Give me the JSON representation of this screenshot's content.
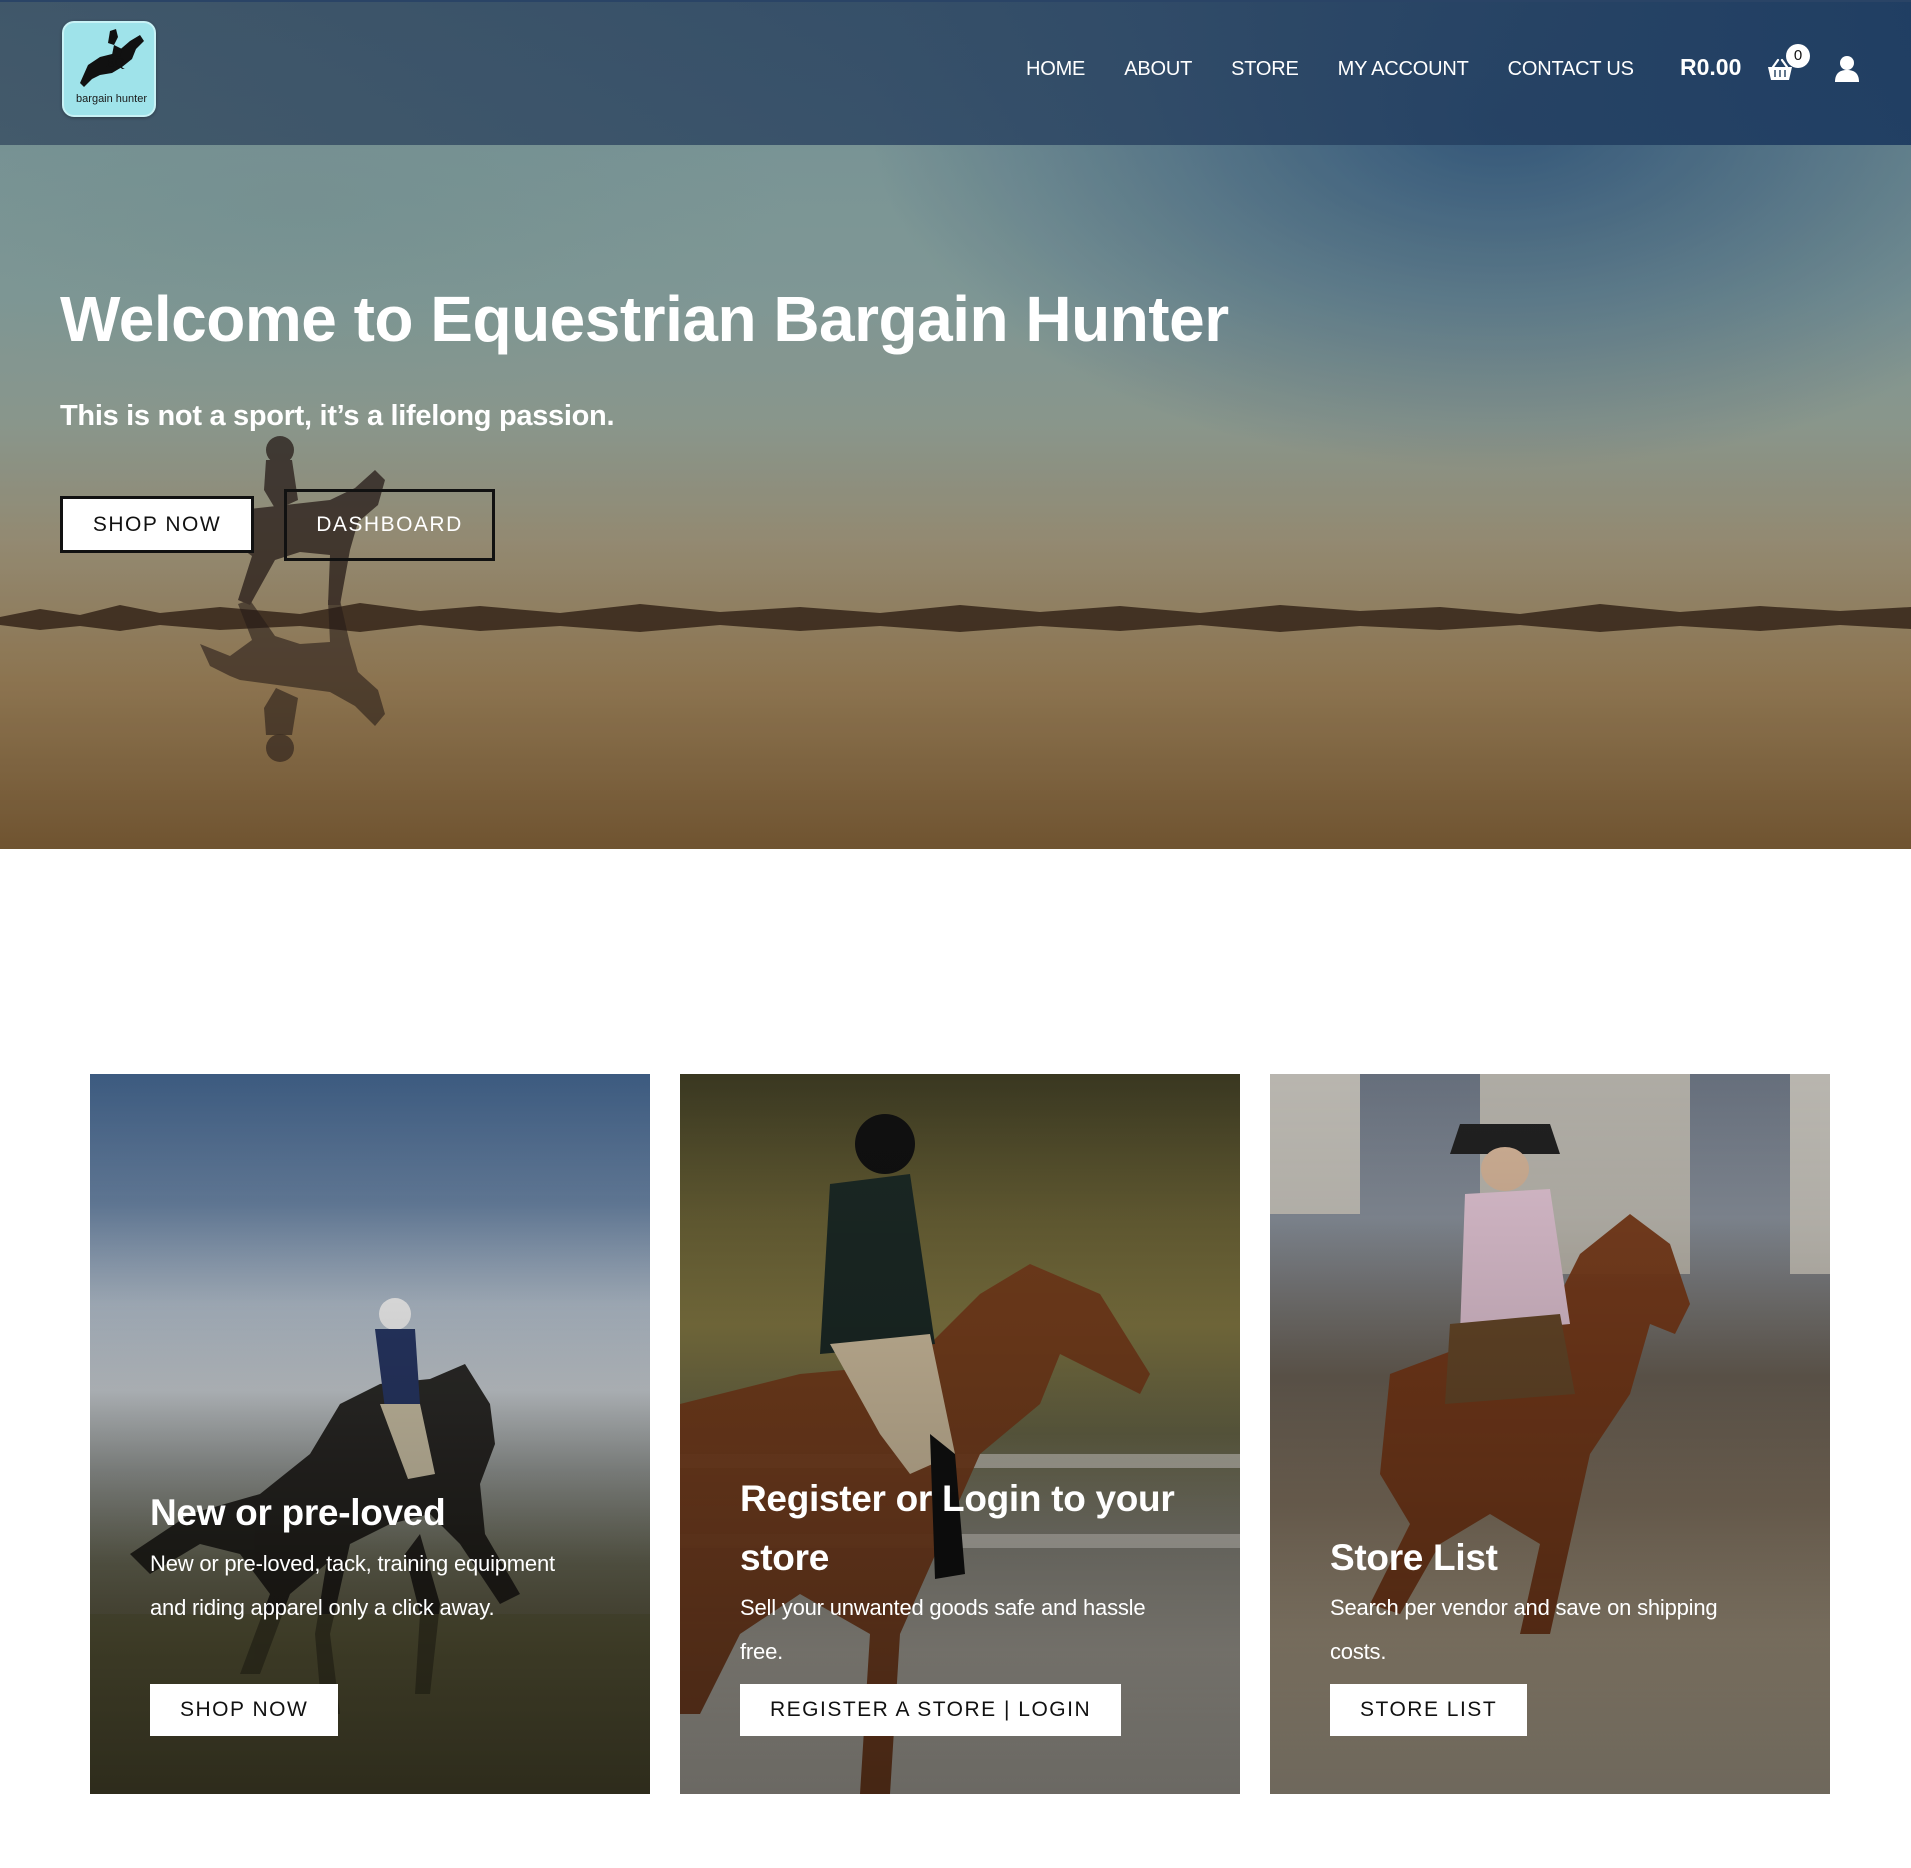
{
  "header": {
    "logo_text": "bargain hunter",
    "nav": [
      "HOME",
      "ABOUT",
      "STORE",
      "MY ACCOUNT",
      "CONTACT US"
    ],
    "cart_total": "R0.00",
    "cart_count": "0"
  },
  "hero": {
    "title": "Welcome to Equestrian Bargain Hunter",
    "subtitle": "This is not a sport, it’s a lifelong passion.",
    "shop_button": "SHOP NOW",
    "dashboard_button": "DASHBOARD"
  },
  "cards": [
    {
      "title": "New or pre-loved",
      "text": "New or pre-loved, tack, training equipment and riding apparel only a click away.",
      "button": "SHOP NOW"
    },
    {
      "title": "Register or Login to your store",
      "text": "Sell your unwanted goods safe and hassle free.",
      "button": "REGISTER A STORE | LOGIN"
    },
    {
      "title": "Store List",
      "text": "Search per vendor and save on shipping costs.",
      "button": "STORE LIST"
    }
  ],
  "icons": {
    "logo": "horse-jumper-logo",
    "cart": "shopping-basket-icon",
    "user": "user-icon"
  },
  "colors": {
    "header_bg": "#3a5570",
    "logo_bg": "#9fe3ea",
    "button_bg": "#ffffff",
    "text_light": "#ffffff"
  }
}
